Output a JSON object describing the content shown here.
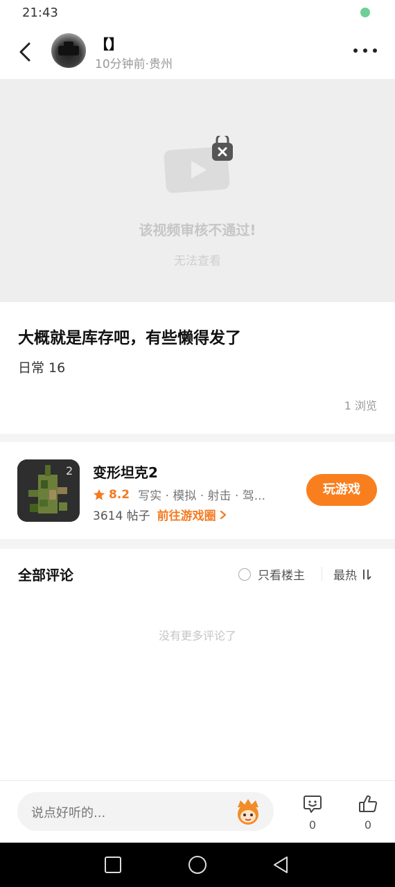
{
  "status_bar": {
    "time": "21:43"
  },
  "header": {
    "username": "【】",
    "meta": "10分钟前·贵州"
  },
  "video": {
    "fail_title": "该视频审核不通过!",
    "fail_subtitle": "无法查看"
  },
  "post": {
    "title": "大概就是库存吧，有些懒得发了",
    "tag": "日常 16",
    "views": "1 浏览"
  },
  "game": {
    "name": "变形坦克2",
    "score": "8.2",
    "tags": "写实 · 模拟 · 射击 · 驾...",
    "posts": "3614 帖子",
    "circle_link": "前往游戏圈",
    "play_label": "玩游戏"
  },
  "comments": {
    "title": "全部评论",
    "only_op": "只看楼主",
    "sort": "最热",
    "empty_text": "没有更多评论了"
  },
  "bottom_bar": {
    "input_placeholder": "说点好听的...",
    "comment_count": "0",
    "like_count": "0"
  },
  "colors": {
    "accent": "#f97f1e",
    "accent_text": "#f47a20"
  },
  "icons": {
    "back": "back-arrow-icon",
    "more": "more-dots-icon",
    "video_locked": "locked-video-icon",
    "star": "star-icon",
    "chevron": "chevron-right-icon",
    "sort": "sort-icon",
    "mascot": "mascot-icon",
    "comment": "comment-icon",
    "like": "thumbs-up-icon"
  }
}
